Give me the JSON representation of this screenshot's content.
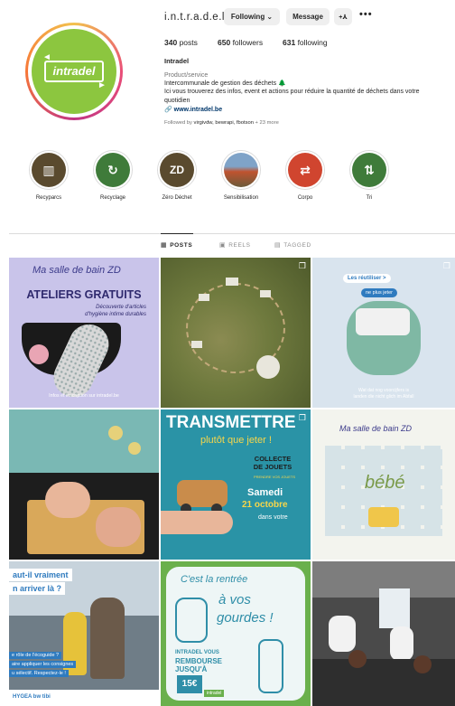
{
  "profile": {
    "username": "i.n.t.r.a.d.e.l",
    "logo_text": "intradel",
    "following_button": "Following ⌄",
    "message_button": "Message",
    "adduser_icon": "+⅄",
    "more_icon": "•••",
    "posts_count": "340",
    "posts_label": "posts",
    "followers_count": "650",
    "followers_label": "followers",
    "following_count": "631",
    "following_label": "following",
    "name": "Intradel",
    "category": "Product/service",
    "bio_line1": "Intercommunale de gestion des déchets 🌲",
    "bio_line2": "Ici vous trouverez des infos, event et actions pour réduire la quantité de déchets dans votre quotidien",
    "link": "www.intradel.be",
    "followed_by_prefix": "Followed by ",
    "followed_by_names": "virgivdw, bewrapi, fbotson",
    "followed_by_more": " + 23 more"
  },
  "highlights": [
    {
      "label": "Recyparcs",
      "icon": "▥",
      "color": "#5a4a2e"
    },
    {
      "label": "Recyclage",
      "icon": "↻",
      "color": "#3f7b3a"
    },
    {
      "label": "Zéro Déchet",
      "icon": "ZD",
      "color": "#5a4a2e"
    },
    {
      "label": "Sensibilisation",
      "icon": "",
      "color": "#8a6e5a"
    },
    {
      "label": "Corpo",
      "icon": "⇄",
      "color": "#d0452f"
    },
    {
      "label": "Tri",
      "icon": "⇅",
      "color": "#3f7b3a"
    }
  ],
  "tabs": [
    {
      "label": "POSTS",
      "icon": "▦"
    },
    {
      "label": "REELS",
      "icon": "▣"
    },
    {
      "label": "TAGGED",
      "icon": "▤"
    }
  ],
  "posts": {
    "p1": {
      "script": "Ma salle de bain ZD",
      "title": "ATELIERS GRATUITS",
      "sub1": "Découverte d'articles",
      "sub2": "d'hygiène intime durables",
      "footer": "Infos et inscription sur intradel.be"
    },
    "p3": {
      "tag1": "Les réutiliser >",
      "tag2": "ne plus jeter",
      "caption1": "Wat dat nog voorcijfers is",
      "caption2": "landen die nicht glich im Abfall"
    },
    "p5": {
      "title": "TRANSMETTRE",
      "subtitle": "plutôt que jeter !",
      "collecte1": "COLLECTE",
      "collecte2": "DE JOUETS",
      "small": "PRENDRE VOS JOUETS",
      "date_day": "Samedi",
      "date": "21 octobre",
      "place": "dans votre"
    },
    "p6": {
      "script": "Ma salle de bain ZD",
      "word": "bébé"
    },
    "p7": {
      "line1": "aut-il vraiment",
      "line2": "n arriver là ?",
      "line3": "e rôle de l'écoguide ?",
      "line4": "aire appliquer les consignes",
      "line5": "u sélectif. Respectez-le !",
      "logos": "HYGEA  bw  tibi"
    },
    "p8": {
      "script1": "C'est la rentrée",
      "script2": "à vos",
      "script3": "gourdes !",
      "body1": "INTRADEL VOUS",
      "body2": "REMBOURSE",
      "body3": "JUSQU'À",
      "price": "15€",
      "brand": "intradel"
    }
  }
}
